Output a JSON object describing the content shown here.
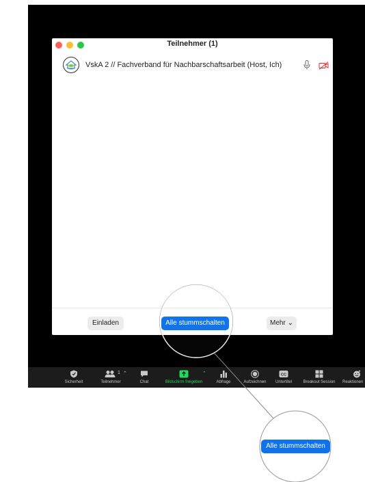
{
  "panel": {
    "title": "Teilnehmer (1)"
  },
  "participant": {
    "name": "VskA 2 // Fachverband für Nachbarschaftsarbeit (Host, Ich)",
    "mic_icon": "microphone-icon",
    "video_icon": "video-off-icon"
  },
  "footer": {
    "invite_label": "Einladen",
    "mute_all_label": "Alle stummschalten",
    "more_label": "Mehr"
  },
  "toolbar": {
    "items": [
      {
        "label": "Sicherheit",
        "icon": "shield-icon"
      },
      {
        "label": "Teilnehmer",
        "icon": "participants-icon",
        "count": "1"
      },
      {
        "label": "Chat",
        "icon": "chat-icon"
      },
      {
        "label": "Bildschirm freigeben",
        "icon": "share-screen-icon"
      },
      {
        "label": "Abfrage",
        "icon": "poll-icon"
      },
      {
        "label": "Aufzeichnen",
        "icon": "record-icon"
      },
      {
        "label": "Untertitel",
        "icon": "cc-icon"
      },
      {
        "label": "Breakout Session",
        "icon": "breakout-icon"
      },
      {
        "label": "Reaktionen",
        "icon": "reaction-icon"
      }
    ]
  },
  "zoom_callout": {
    "label": "Alle stummschalten"
  },
  "colors": {
    "accent_blue": "#0e72ed",
    "share_green": "#23d959",
    "video_off_red": "#e02828"
  }
}
